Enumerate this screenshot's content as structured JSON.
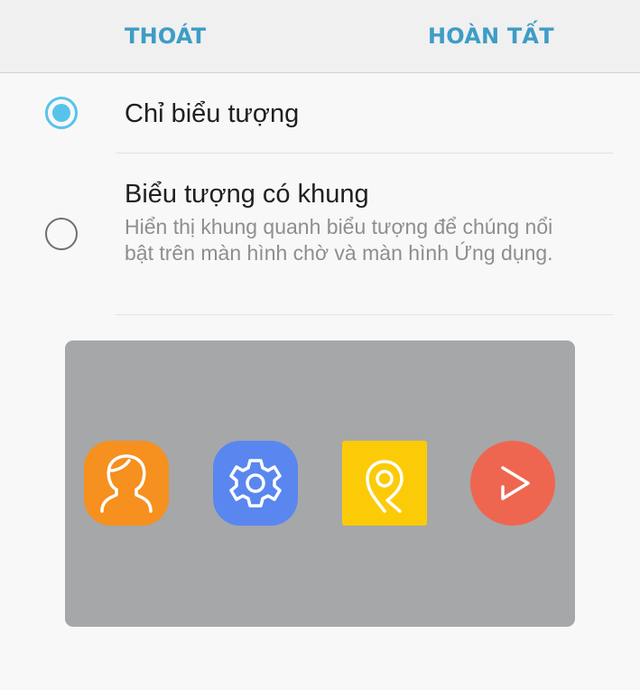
{
  "topbar": {
    "exit_label": "THOÁT",
    "done_label": "HOÀN TẤT"
  },
  "options": [
    {
      "title": "Chỉ biểu tượng",
      "selected": true
    },
    {
      "title": "Biểu tượng có khung",
      "description": "Hiển thị khung quanh biểu tượng để chúng nổi bật trên màn hình chờ và màn hình Ứng dụng.",
      "selected": false
    }
  ],
  "preview": {
    "background": "#a6a7a9",
    "icons": [
      {
        "name": "contacts-icon",
        "color": "#f6901e",
        "shape": "squircle"
      },
      {
        "name": "settings-icon",
        "color": "#5a86f0",
        "shape": "squircle"
      },
      {
        "name": "maps-pin-icon",
        "color": "#fccb08",
        "shape": "square"
      },
      {
        "name": "video-play-icon",
        "color": "#ee6650",
        "shape": "circle"
      }
    ]
  },
  "colors": {
    "accent": "#3d9dc6",
    "radio_selected": "#58c3ea"
  }
}
